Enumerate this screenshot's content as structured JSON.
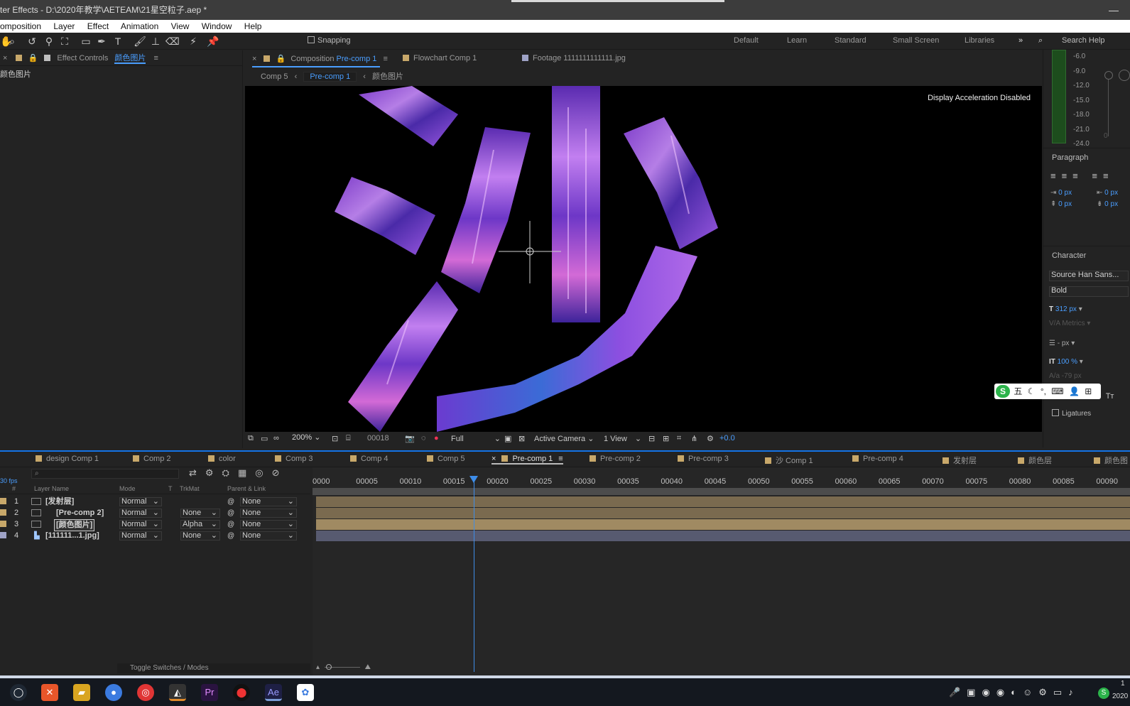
{
  "title": "ter Effects - D:\\2020年教学\\AETEAM\\21星空粒子.aep *",
  "menu": [
    "omposition",
    "Layer",
    "Effect",
    "Animation",
    "View",
    "Window",
    "Help"
  ],
  "toolbar": {
    "snapping_label": "Snapping",
    "workspaces": [
      "Default",
      "Learn",
      "Standard",
      "Small Screen",
      "Libraries"
    ],
    "overflow": "»",
    "search_placeholder": "Search Help"
  },
  "effect_controls": {
    "tab_label": "Effect Controls",
    "tab_layer": "颜色图片",
    "layer_name": "颜色图片"
  },
  "composition": {
    "tab_prefix": "Composition",
    "tab_name": "Pre-comp 1",
    "other_tabs": [
      "Flowchart Comp 1",
      "Footage 1111111111111.jpg"
    ],
    "breadcrumbs": [
      "Comp 5",
      "Pre-comp 1",
      "颜色图片"
    ],
    "viewer_notice": "Display Acceleration Disabled",
    "glyph": "沙"
  },
  "viewer_bar": {
    "zoom": "200%",
    "timecode": "00018",
    "resolution": "Full",
    "camera": "Active Camera",
    "views": "1 View",
    "exposure": "+0.0"
  },
  "audio_meter": {
    "labels": [
      "-6.0",
      "-9.0",
      "-12.0",
      "-15.0",
      "-18.0",
      "-21.0",
      "-24.0"
    ],
    "zero_label": "0"
  },
  "paragraph": {
    "title": "Paragraph",
    "indent_left": "0 px",
    "indent_right": "0 px",
    "space_before": "0 px",
    "space_after": "0 px"
  },
  "character": {
    "title": "Character",
    "font": "Source Han Sans...",
    "style": "Bold",
    "size": "312 px",
    "kerning": "Metrics",
    "leading": "- px",
    "vscale": "100 %",
    "tracking": "-79 px",
    "ligatures": "Ligatures",
    "style_buttons": [
      "T",
      "T",
      "TT",
      "Tт"
    ]
  },
  "ime": [
    "五",
    "☾",
    "°,",
    "⌨",
    "👤",
    "⊞"
  ],
  "timeline": {
    "tabs": [
      "design Comp 1",
      "Comp 2",
      "color",
      "Comp 3",
      "Comp 4",
      "Comp 5",
      "Pre-comp 1",
      "Pre-comp 2",
      "Pre-comp 3",
      "沙 Comp 1",
      "Pre-comp 4",
      "发射层",
      "颜色层",
      "颜色图"
    ],
    "active_tab": "Pre-comp 1",
    "fps": "30 fps",
    "search_placeholder": "",
    "columns": {
      "num": "#",
      "name": "Layer Name",
      "mode": "Mode",
      "t": "T",
      "trkmat": "TrkMat",
      "parent": "Parent & Link"
    },
    "layers": [
      {
        "num": "1",
        "name": "[发射层]",
        "mode": "Normal",
        "trkmat": "",
        "parent": "None",
        "color": "#c8a86a"
      },
      {
        "num": "2",
        "name": "[Pre-comp 2]",
        "mode": "Normal",
        "trkmat": "None",
        "parent": "None",
        "color": "#c8a86a"
      },
      {
        "num": "3",
        "name": "[颜色图片]",
        "mode": "Normal",
        "trkmat": "Alpha",
        "parent": "None",
        "color": "#c8a86a"
      },
      {
        "num": "4",
        "name": "[111111...1.jpg]",
        "mode": "Normal",
        "trkmat": "None",
        "parent": "None",
        "color": "#9fa3c7"
      }
    ],
    "ruler": [
      "0000",
      "00005",
      "00010",
      "00015",
      "00020",
      "00025",
      "00030",
      "00035",
      "00040",
      "00045",
      "00050",
      "00055",
      "00060",
      "00065",
      "00070",
      "00075",
      "00080",
      "00085",
      "00090"
    ],
    "current_frame": 18,
    "toggle_label": "Toggle Switches / Modes"
  },
  "taskbar": {
    "clock_top": "1",
    "clock_bottom": "2020"
  }
}
